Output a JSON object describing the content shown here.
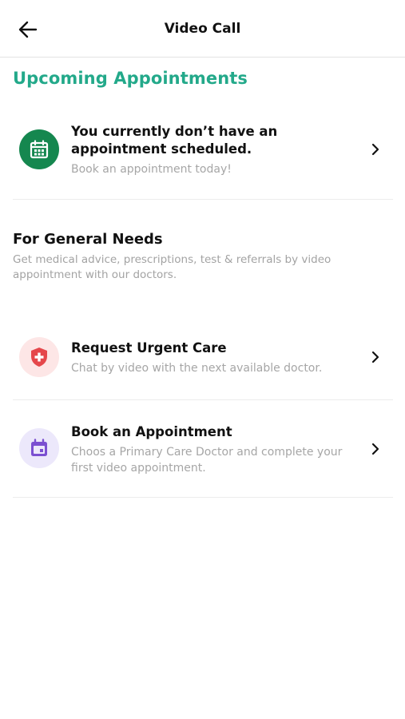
{
  "header": {
    "title": "Video Call",
    "back_icon": "arrow-left-icon"
  },
  "upcoming": {
    "heading": "Upcoming Appointments",
    "heading_color": "#23a98a",
    "card": {
      "icon": "calendar-icon",
      "icon_bg": "#15874f",
      "title": "You currently don’t have an appointment scheduled.",
      "subtitle": "Book an appointment today!"
    }
  },
  "general": {
    "title": "For General Needs",
    "subtitle": "Get medical advice, prescriptions, test & referrals by video appointment with our doctors.",
    "items": [
      {
        "icon": "shield-plus-icon",
        "icon_bg": "#fde6e6",
        "icon_color": "#e5474b",
        "title": "Request Urgent Care",
        "subtitle": "Chat by video with the next available doctor."
      },
      {
        "icon": "calendar-icon",
        "icon_bg": "#ece8fb",
        "icon_color": "#7b4fd1",
        "title": "Book an Appointment",
        "subtitle": "Choos a Primary Care Doctor and complete your first video appointment."
      }
    ]
  }
}
